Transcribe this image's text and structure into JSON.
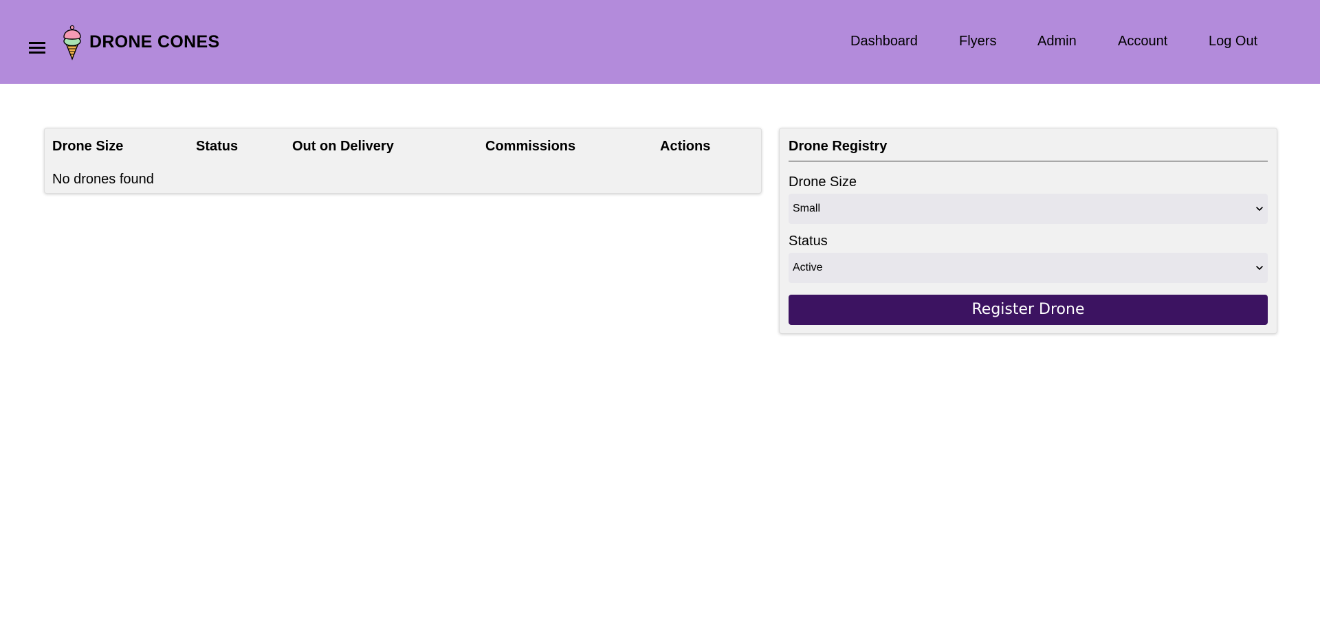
{
  "header": {
    "brand": "DRONE CONES",
    "nav": [
      "Dashboard",
      "Flyers",
      "Admin",
      "Account",
      "Log Out"
    ]
  },
  "table": {
    "columns": [
      "Drone Size",
      "Status",
      "Out on Delivery",
      "Commissions",
      "Actions"
    ],
    "empty_message": "No drones found"
  },
  "registry": {
    "title": "Drone Registry",
    "size_label": "Drone Size",
    "size_value": "Small",
    "status_label": "Status",
    "status_value": "Active",
    "submit_label": "Register Drone"
  },
  "colors": {
    "header_bg": "#b38bdb",
    "button_bg": "#3c1361",
    "card_bg": "#f1f1f1",
    "select_bg": "#e8e7ec"
  },
  "icons": {
    "menu": "hamburger-icon",
    "logo": "ice-cream-cone-icon",
    "dropdown": "chevron-down-icon"
  }
}
